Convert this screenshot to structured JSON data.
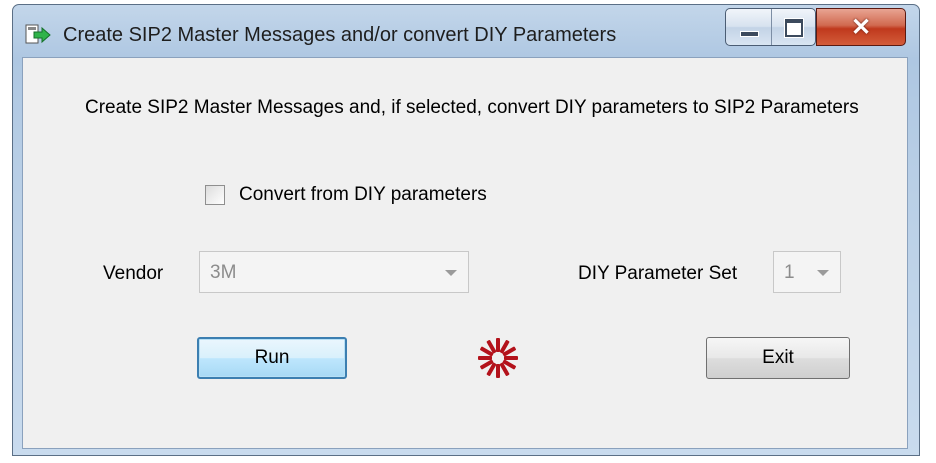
{
  "window": {
    "title": "Create SIP2 Master Messages and/or convert DIY Parameters",
    "close_glyph": "✕"
  },
  "description": "Create SIP2 Master Messages and, if selected,  convert DIY parameters to SIP2 Parameters",
  "convert_checkbox": {
    "label": "Convert from DIY parameters",
    "checked": false
  },
  "vendor": {
    "label": "Vendor",
    "value": "3M",
    "enabled": false
  },
  "diy_parameter_set": {
    "label": "DIY Parameter Set",
    "value": "1",
    "enabled": false
  },
  "buttons": {
    "run": "Run",
    "exit": "Exit"
  },
  "icons": {
    "app": "arrow-window-icon",
    "busy": "busy-spinner-icon"
  },
  "colors": {
    "spinner": "#b3121b",
    "close_button": "#c0391d"
  }
}
